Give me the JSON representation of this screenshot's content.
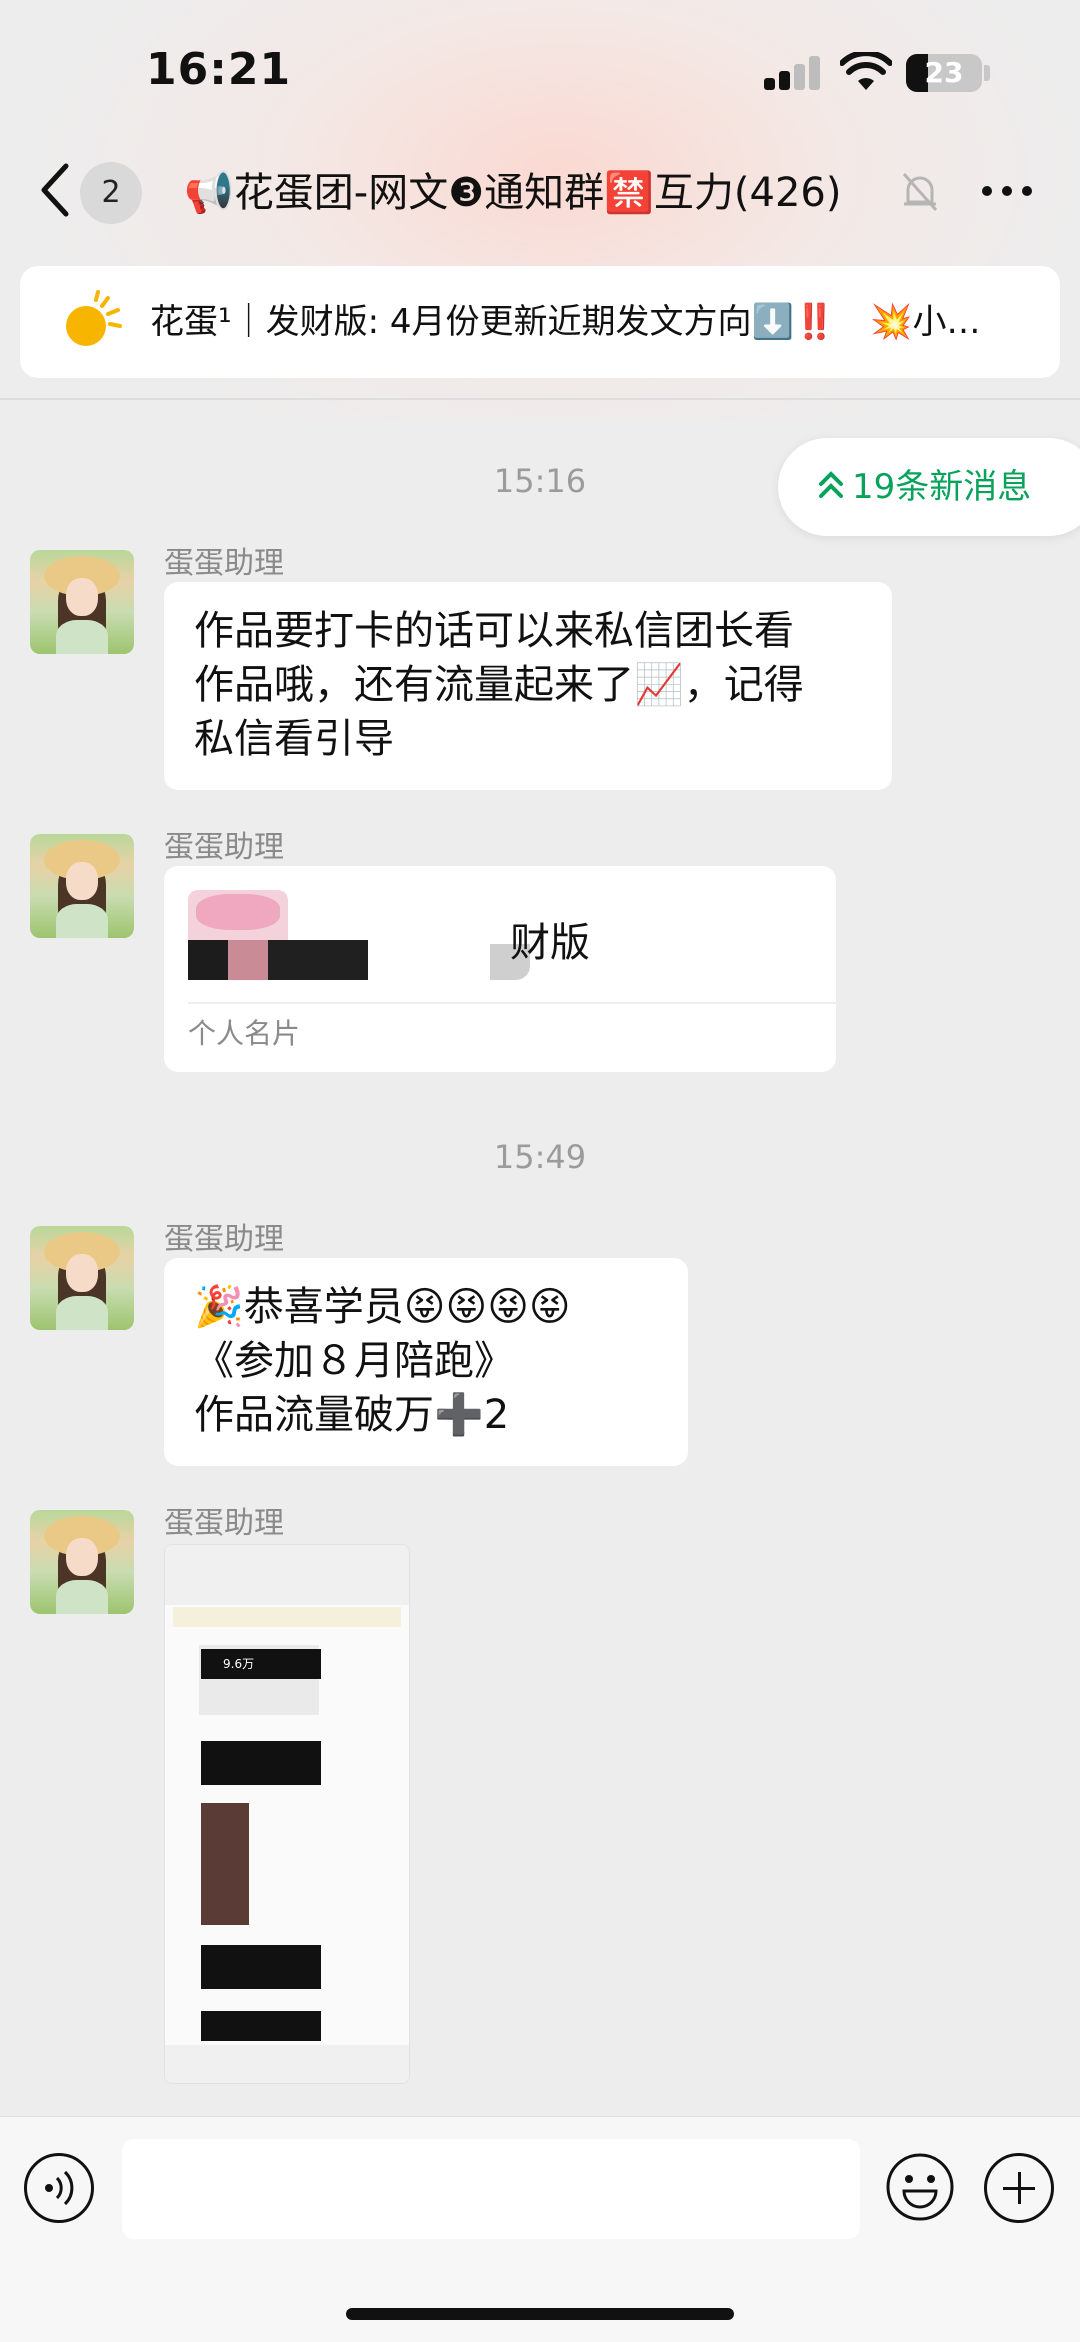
{
  "status_bar": {
    "time": "16:21",
    "battery": "23"
  },
  "nav": {
    "unread_count": "2",
    "title": "📢花蛋团-网文❸通知群🈲互力(426)"
  },
  "pinned": {
    "text": "花蛋¹｜发财版: 4月份更新近期发文方向⬇️‼️　💥小…"
  },
  "new_messages_pill": "19条新消息",
  "timestamps": [
    "15:16",
    "15:49"
  ],
  "messages": [
    {
      "sender": "蛋蛋助理",
      "text": "作品要打卡的话可以来私信团长看\n作品哦，还有流量起来了📈，记得\n私信看引导"
    },
    {
      "sender": "蛋蛋助理",
      "card_name": "财版",
      "card_type": "个人名片"
    },
    {
      "sender": "蛋蛋助理",
      "text": "🎉恭喜学员😝😝😝😝\n《参加８月陪跑》\n作品流量破万➕2"
    },
    {
      "sender": "蛋蛋助理",
      "image_snippet": {
        "views": "9.6万"
      }
    }
  ]
}
